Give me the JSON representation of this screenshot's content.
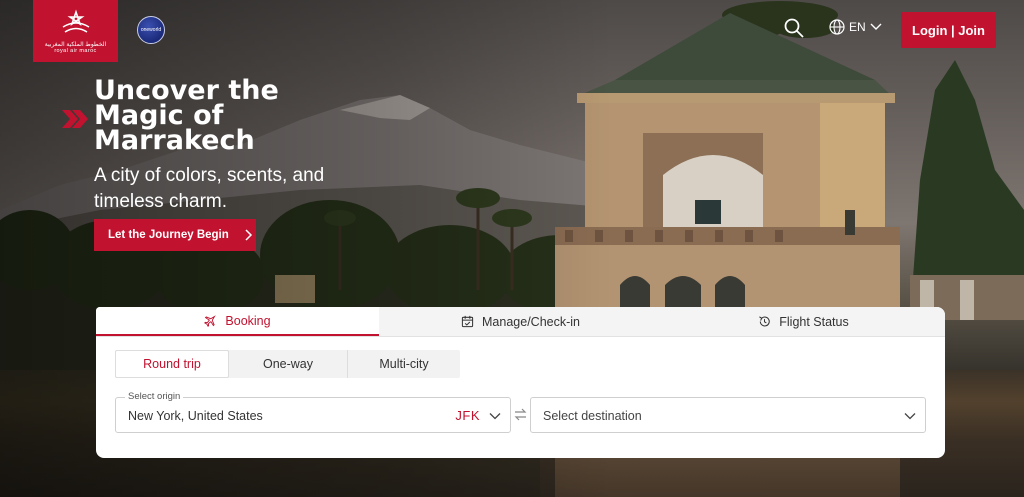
{
  "brand": {
    "logo_arabic": "الخطوط الملكية المغربية",
    "logo_english": "royal air maroc",
    "alliance_badge": "oneworld",
    "accent": "#c1122f"
  },
  "header": {
    "search_icon": "search-icon",
    "language": "EN",
    "login_label": "Login | Join"
  },
  "hero": {
    "title": "Uncover the Magic of Marrakech",
    "subtitle": "A city of colors, scents, and timeless charm.",
    "cta_label": "Let the Journey Begin"
  },
  "booking": {
    "tabs": [
      {
        "label": "Booking",
        "icon": "plane-icon",
        "active": true
      },
      {
        "label": "Manage/Check-in",
        "icon": "calendar-icon",
        "active": false
      },
      {
        "label": "Flight Status",
        "icon": "history-icon",
        "active": false
      }
    ],
    "trip_types": [
      {
        "label": "Round trip",
        "active": true
      },
      {
        "label": "One-way",
        "active": false
      },
      {
        "label": "Multi-city",
        "active": false
      }
    ],
    "origin": {
      "label": "Select origin",
      "value": "New York, United States",
      "code": "JFK"
    },
    "destination": {
      "placeholder": "Select destination"
    }
  }
}
